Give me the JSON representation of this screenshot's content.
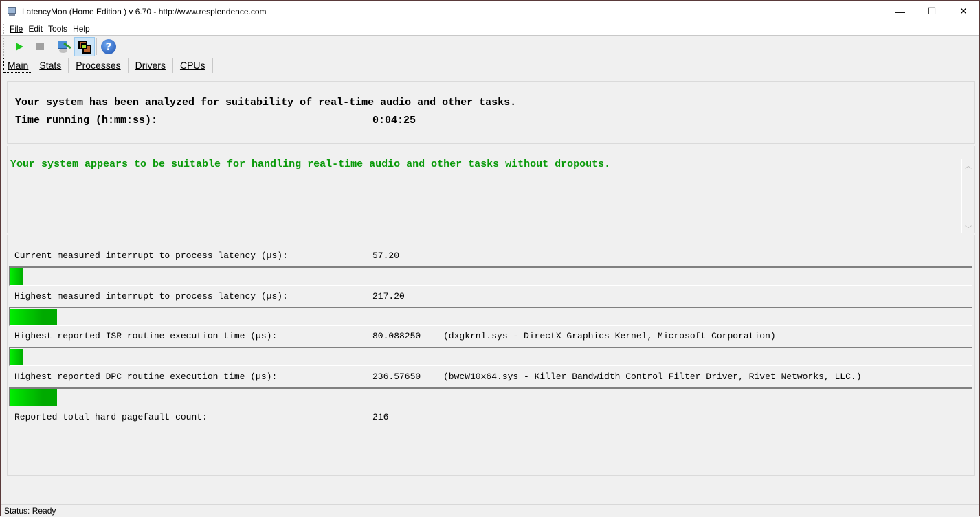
{
  "window": {
    "title": "LatencyMon  (Home Edition )  v 6.70 - http://www.resplendence.com",
    "controls": {
      "minimize": "—",
      "maximize": "☐",
      "close": "✕"
    }
  },
  "menu": [
    "File",
    "Edit",
    "Tools",
    "Help"
  ],
  "toolbar": {
    "buttons": [
      {
        "name": "start-monitor",
        "icon": "play-icon"
      },
      {
        "name": "stop-monitor",
        "icon": "stop-icon"
      },
      {
        "name": "drivers-info",
        "icon": "driver-monitor-icon"
      },
      {
        "name": "window-view",
        "icon": "windows-icon",
        "active": true
      },
      {
        "name": "help",
        "icon": "help-icon",
        "glyph": "?"
      }
    ]
  },
  "tabs": [
    {
      "label": "Main",
      "selected": true
    },
    {
      "label": "Stats"
    },
    {
      "label": "Processes"
    },
    {
      "label": "Drivers"
    },
    {
      "label": "CPUs"
    }
  ],
  "summary": {
    "line1": "Your system has been analyzed for suitability of real-time audio and other tasks.",
    "time_label": "Time running (h:mm:ss):",
    "time_value": "0:04:25"
  },
  "verdict": {
    "text": "Your system appears to be suitable for handling real-time audio and other tasks without dropouts.",
    "color": "#0a9a0a"
  },
  "metrics": [
    {
      "label": "Current measured interrupt to process latency (µs):",
      "value": "57.20",
      "extra": "",
      "bar_segments": 1
    },
    {
      "label": "Highest measured interrupt to process latency (µs):",
      "value": "217.20",
      "extra": "",
      "bar_segments": 4
    },
    {
      "label": "Highest reported ISR routine execution time (µs):",
      "value": "80.088250",
      "extra": "(dxgkrnl.sys - DirectX Graphics Kernel, Microsoft Corporation)",
      "bar_segments": 1
    },
    {
      "label": "Highest reported DPC routine execution time (µs):",
      "value": "236.57650",
      "extra": "(bwcW10x64.sys - Killer Bandwidth Control Filter Driver, Rivet Networks, LLC.)",
      "bar_segments": 4
    },
    {
      "label": "Reported total hard pagefault count:",
      "value": "216",
      "extra": ""
    }
  ],
  "bar_colors": [
    "#00ee00",
    "#00d600",
    "#00c000",
    "#00aa00"
  ],
  "status": "Status: Ready"
}
